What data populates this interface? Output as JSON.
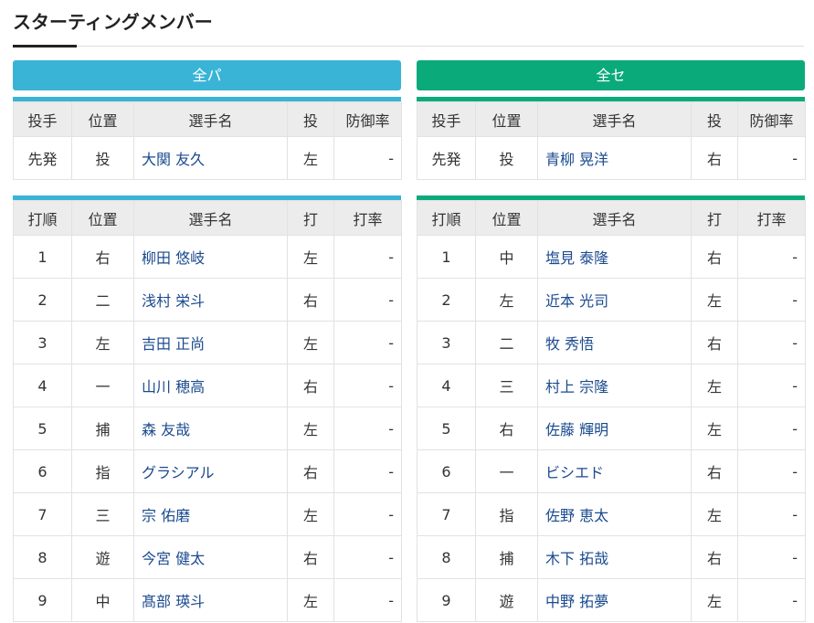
{
  "page": {
    "title": "スターティングメンバー"
  },
  "teams": [
    {
      "name": "全パ",
      "pitcher_headers": [
        "投手",
        "位置",
        "選手名",
        "投",
        "防御率"
      ],
      "pitcher": {
        "role": "先発",
        "pos": "投",
        "name": "大関 友久",
        "hand": "左",
        "stat": "-"
      },
      "batting_headers": [
        "打順",
        "位置",
        "選手名",
        "打",
        "打率"
      ],
      "lineup": [
        {
          "order": "1",
          "pos": "右",
          "name": "柳田 悠岐",
          "hand": "左",
          "stat": "-"
        },
        {
          "order": "2",
          "pos": "二",
          "name": "浅村 栄斗",
          "hand": "右",
          "stat": "-"
        },
        {
          "order": "3",
          "pos": "左",
          "name": "吉田 正尚",
          "hand": "左",
          "stat": "-"
        },
        {
          "order": "4",
          "pos": "一",
          "name": "山川 穂高",
          "hand": "右",
          "stat": "-"
        },
        {
          "order": "5",
          "pos": "捕",
          "name": "森 友哉",
          "hand": "左",
          "stat": "-"
        },
        {
          "order": "6",
          "pos": "指",
          "name": "グラシアル",
          "hand": "右",
          "stat": "-"
        },
        {
          "order": "7",
          "pos": "三",
          "name": "宗 佑磨",
          "hand": "左",
          "stat": "-"
        },
        {
          "order": "8",
          "pos": "遊",
          "name": "今宮 健太",
          "hand": "右",
          "stat": "-"
        },
        {
          "order": "9",
          "pos": "中",
          "name": "髙部 瑛斗",
          "hand": "左",
          "stat": "-"
        }
      ]
    },
    {
      "name": "全セ",
      "pitcher_headers": [
        "投手",
        "位置",
        "選手名",
        "投",
        "防御率"
      ],
      "pitcher": {
        "role": "先発",
        "pos": "投",
        "name": "青柳 晃洋",
        "hand": "右",
        "stat": "-"
      },
      "batting_headers": [
        "打順",
        "位置",
        "選手名",
        "打",
        "打率"
      ],
      "lineup": [
        {
          "order": "1",
          "pos": "中",
          "name": "塩見 泰隆",
          "hand": "右",
          "stat": "-"
        },
        {
          "order": "2",
          "pos": "左",
          "name": "近本 光司",
          "hand": "左",
          "stat": "-"
        },
        {
          "order": "3",
          "pos": "二",
          "name": "牧 秀悟",
          "hand": "右",
          "stat": "-"
        },
        {
          "order": "4",
          "pos": "三",
          "name": "村上 宗隆",
          "hand": "左",
          "stat": "-"
        },
        {
          "order": "5",
          "pos": "右",
          "name": "佐藤 輝明",
          "hand": "左",
          "stat": "-"
        },
        {
          "order": "6",
          "pos": "一",
          "name": "ビシエド",
          "hand": "右",
          "stat": "-"
        },
        {
          "order": "7",
          "pos": "指",
          "name": "佐野 恵太",
          "hand": "左",
          "stat": "-"
        },
        {
          "order": "8",
          "pos": "捕",
          "name": "木下 拓哉",
          "hand": "右",
          "stat": "-"
        },
        {
          "order": "9",
          "pos": "遊",
          "name": "中野 拓夢",
          "hand": "左",
          "stat": "-"
        }
      ]
    }
  ]
}
